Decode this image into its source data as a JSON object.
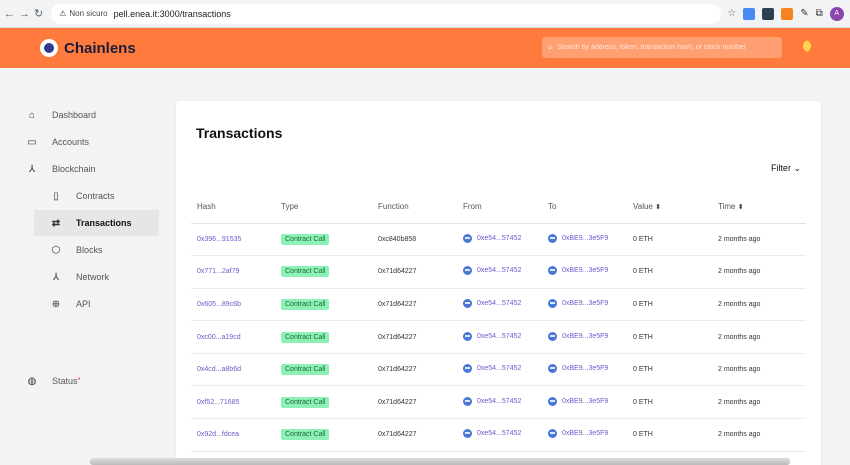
{
  "browser": {
    "security_label": "Non sicuro",
    "url": "pell.enea.it:3000/transactions",
    "avatar_letter": "A"
  },
  "header": {
    "brand": "Chainlens",
    "search_placeholder": "Search by address, token, transaction hash, or block number",
    "accent": "#ff7a3d"
  },
  "sidebar": {
    "items": [
      {
        "label": "Dashboard",
        "icon": "home-icon"
      },
      {
        "label": "Accounts",
        "icon": "wallet-icon"
      },
      {
        "label": "Blockchain",
        "icon": "network-icon"
      },
      {
        "label": "Contracts",
        "icon": "document-icon"
      },
      {
        "label": "Transactions",
        "icon": "swap-icon"
      },
      {
        "label": "Blocks",
        "icon": "cube-icon"
      },
      {
        "label": "Network",
        "icon": "network-icon"
      },
      {
        "label": "API",
        "icon": "globe-icon"
      },
      {
        "label": "Status",
        "icon": "status-icon"
      }
    ],
    "status_marker": "*"
  },
  "main": {
    "title": "Transactions",
    "filter_label": "Filter",
    "columns": [
      "Hash",
      "Type",
      "Function",
      "From",
      "To",
      "Value",
      "Time"
    ],
    "rows": [
      {
        "hash": "0x396...91535",
        "type": "Contract Call",
        "function": "0xc840b858",
        "from": "0xe54...57452",
        "to": "0xBE9...3e5F9",
        "value": "0 ETH",
        "time": "2 months ago"
      },
      {
        "hash": "0x771...2af79",
        "type": "Contract Call",
        "function": "0x71d64227",
        "from": "0xe54...57452",
        "to": "0xBE9...3e5F9",
        "value": "0 ETH",
        "time": "2 months ago"
      },
      {
        "hash": "0x605...89c6b",
        "type": "Contract Call",
        "function": "0x71d64227",
        "from": "0xe54...57452",
        "to": "0xBE9...3e5F9",
        "value": "0 ETH",
        "time": "2 months ago"
      },
      {
        "hash": "0xc00...a19cd",
        "type": "Contract Call",
        "function": "0x71d64227",
        "from": "0xe54...57452",
        "to": "0xBE9...3e5F9",
        "value": "0 ETH",
        "time": "2 months ago"
      },
      {
        "hash": "0x4cd...a8b6d",
        "type": "Contract Call",
        "function": "0x71d64227",
        "from": "0xe54...57452",
        "to": "0xBE9...3e5F9",
        "value": "0 ETH",
        "time": "2 months ago"
      },
      {
        "hash": "0xf52...71685",
        "type": "Contract Call",
        "function": "0x71d64227",
        "from": "0xe54...57452",
        "to": "0xBE9...3e5F9",
        "value": "0 ETH",
        "time": "2 months ago"
      },
      {
        "hash": "0x92d...fdcea",
        "type": "Contract Call",
        "function": "0x71d64227",
        "from": "0xe54...57452",
        "to": "0xBE9...3e5F9",
        "value": "0 ETH",
        "time": "2 months ago"
      }
    ]
  }
}
